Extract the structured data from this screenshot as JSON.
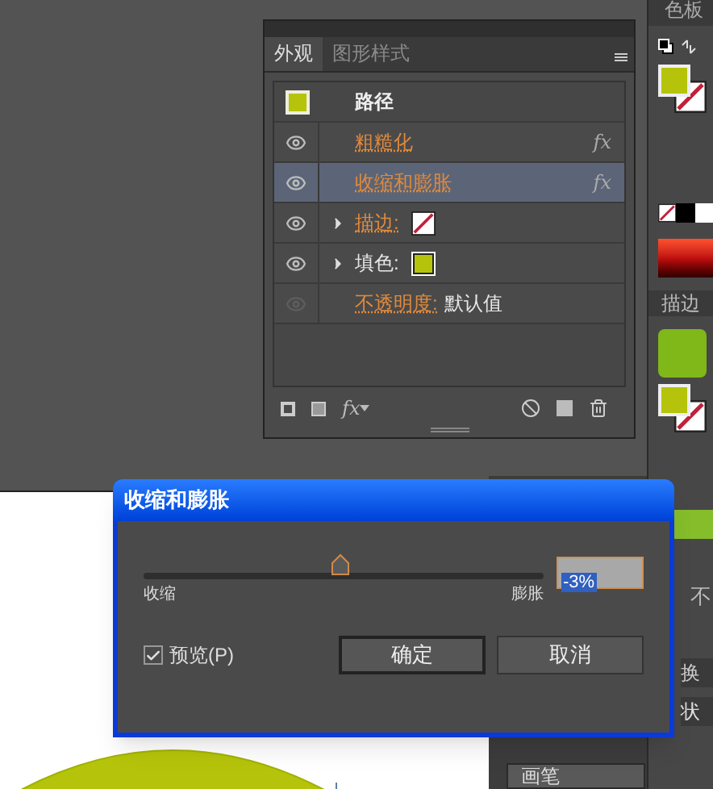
{
  "appearance_panel": {
    "tabs": [
      {
        "label": "外观",
        "selected": true
      },
      {
        "label": "图形样式",
        "selected": false
      }
    ],
    "header": {
      "title": "路径",
      "color": "#b5c40a"
    },
    "rows": [
      {
        "kind": "effect",
        "label": "粗糙化",
        "visible": true,
        "selected": false,
        "fx": "fx"
      },
      {
        "kind": "effect",
        "label": "收缩和膨胀",
        "visible": true,
        "selected": true,
        "fx": "fx"
      },
      {
        "kind": "stroke",
        "label": "描边:",
        "visible": true,
        "selected": false
      },
      {
        "kind": "fill",
        "label": "填色:",
        "visible": true,
        "selected": false,
        "color": "#b5c40a"
      },
      {
        "kind": "opacity",
        "label": "不透明度:",
        "value": "默认值",
        "visible": false,
        "selected": false
      }
    ],
    "footer": {
      "fx": "fx"
    }
  },
  "side_panel": {
    "tabs": [
      {
        "label": "色板"
      },
      {
        "label": "描边"
      }
    ],
    "cut_texts": [
      "不",
      "换",
      "状"
    ]
  },
  "bottom_panel": {
    "tab": "画笔"
  },
  "dialog": {
    "title": "收缩和膨胀",
    "slider": {
      "level": 0.49,
      "min_label": "收缩",
      "max_label": "膨胀"
    },
    "value": "-3%",
    "preview": {
      "label": "预览(P)",
      "checked": true
    },
    "buttons": [
      {
        "label": "确定",
        "default": true
      },
      {
        "label": "取消",
        "default": false
      }
    ]
  }
}
